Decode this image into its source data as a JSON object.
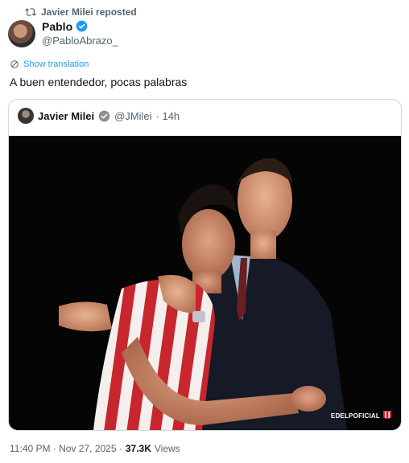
{
  "repost": {
    "label": "Javier Milei reposted"
  },
  "author": {
    "name": "Pablo",
    "handle": "@PabloAbrazo_"
  },
  "translation": {
    "label": "Show translation"
  },
  "tweet": {
    "text": "A buen entendedor, pocas palabras"
  },
  "quote": {
    "name": "Javier Milei",
    "handle": "@JMilei",
    "time": "· 14h",
    "watermark": "EDELPOFICIAL"
  },
  "footer": {
    "timestamp": "11:40 PM · Nov 27, 2025 ·",
    "views": "37.3K",
    "views_label": "Views"
  },
  "colors": {
    "accent": "#1d9bf0",
    "muted": "#536471",
    "verified": "#1d9bf0",
    "gold_verified": "#8a8f95"
  },
  "icons": {
    "repost": "repost-icon",
    "verified": "verified-badge-icon",
    "translate": "globe-icon"
  }
}
